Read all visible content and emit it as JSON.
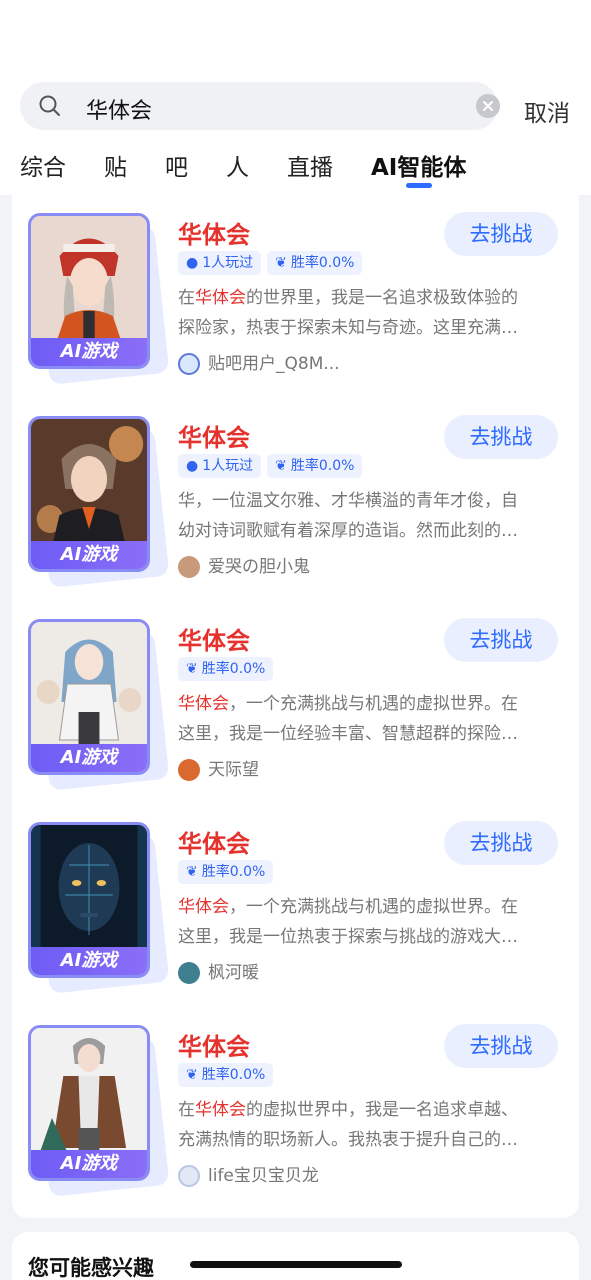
{
  "search": {
    "query": "华体会",
    "cancel": "取消"
  },
  "tabs": [
    {
      "label": "综合"
    },
    {
      "label": "贴"
    },
    {
      "label": "吧"
    },
    {
      "label": "人"
    },
    {
      "label": "直播"
    },
    {
      "label": "AI智能体"
    }
  ],
  "active_tab": "AI智能体",
  "results": [
    {
      "title": "华体会",
      "button": "去挑战",
      "thumb_label": "AI游戏",
      "played": "1人玩过",
      "winrate": "胜率0.0%",
      "desc_pre": "在",
      "desc_hl": "华体会",
      "desc_post": "的世界里，我是一名追求极致体验的",
      "desc_line2": "探险家，热衷于探索未知与奇迹。这里充满…",
      "author": "贴吧用户_Q8M..."
    },
    {
      "title": "华体会",
      "button": "去挑战",
      "thumb_label": "AI游戏",
      "played": "1人玩过",
      "winrate": "胜率0.0%",
      "desc_pre": "华，一位温文尔雅、才华横溢的青年才俊，自",
      "desc_hl": "",
      "desc_post": "",
      "desc_line2": "幼对诗词歌赋有着深厚的造诣。然而此刻的…",
      "author": "爱哭の胆小鬼"
    },
    {
      "title": "华体会",
      "button": "去挑战",
      "thumb_label": "AI游戏",
      "played": "",
      "winrate": "胜率0.0%",
      "desc_pre": "",
      "desc_hl": "华体会",
      "desc_post": "，一个充满挑战与机遇的虚拟世界。在",
      "desc_line2": "这里，我是一位经验丰富、智慧超群的探险…",
      "author": "天际望"
    },
    {
      "title": "华体会",
      "button": "去挑战",
      "thumb_label": "AI游戏",
      "played": "",
      "winrate": "胜率0.0%",
      "desc_pre": "",
      "desc_hl": "华体会",
      "desc_post": "，一个充满挑战与机遇的虚拟世界。在",
      "desc_line2": "这里，我是一位热衷于探索与挑战的游戏大…",
      "author": "枫河暖"
    },
    {
      "title": "华体会",
      "button": "去挑战",
      "thumb_label": "AI游戏",
      "played": "",
      "winrate": "胜率0.0%",
      "desc_pre": "在",
      "desc_hl": "华体会",
      "desc_post": "的虚拟世界中，我是一名追求卓越、",
      "desc_line2": "充满热情的职场新人。我热衷于提升自己的…",
      "author": "life宝贝宝贝龙"
    }
  ],
  "interest": {
    "title": "您可能感兴趣"
  },
  "colors": {
    "accent": "#2e6bff",
    "highlight": "#e5322d",
    "ai_label": "#7a63f6"
  },
  "icons": {
    "search": "search-icon",
    "clear": "clear-icon",
    "played": "robot-icon",
    "winrate": "laurel-icon"
  }
}
